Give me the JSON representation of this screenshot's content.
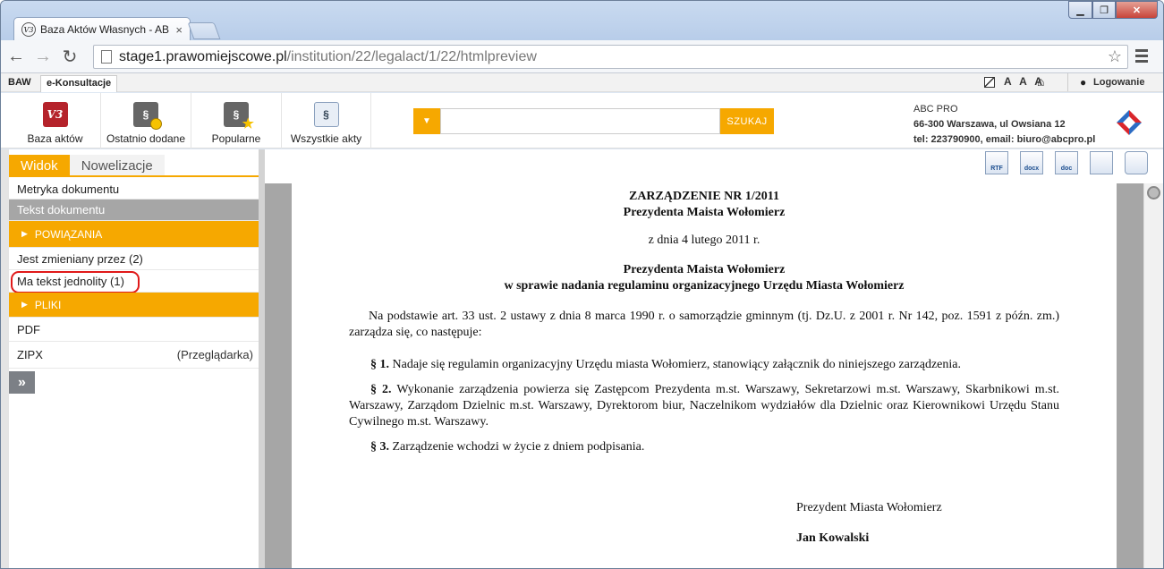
{
  "browser": {
    "tab_title": "Baza Aktów Własnych - AB",
    "favicon_text": "V3",
    "url_host": "stage1.prawomiejscowe.pl",
    "url_path": "/institution/22/legalact/1/22/htmlpreview"
  },
  "sitebar": {
    "baw": "BAW",
    "konsultacje": "e-Konsultacje",
    "accessibility": "A A A",
    "login": "Logowanie"
  },
  "header": {
    "items": [
      {
        "label": "Baza aktów",
        "icon": "baza-aktow-logo-icon"
      },
      {
        "label": "Ostatnio dodane",
        "icon": "recently-added-icon"
      },
      {
        "label": "Popularne",
        "icon": "popular-icon"
      },
      {
        "label": "Wszystkie akty",
        "icon": "all-acts-icon"
      }
    ],
    "search_button": "SZUKAJ",
    "company": {
      "name": "ABC PRO",
      "address": "66-300 Warszawa, ul Owsiana 12",
      "contact": "tel: 223790900, email: biuro@abcpro.pl"
    }
  },
  "left_panel": {
    "tabs": [
      "Widok",
      "Nowelizacje"
    ],
    "rows": {
      "metryka": "Metryka dokumentu",
      "tekst": "Tekst dokumentu",
      "powiazania": "POWIĄZANIA",
      "zmieniany": "Jest zmieniany przez (2)",
      "jednolity": "Ma tekst jednolity (1)",
      "pliki": "PLIKI",
      "pdf": "PDF",
      "zipx": "ZIPX",
      "zipx_right": "(Przeglądarka)"
    },
    "expand": "»"
  },
  "file_icons": [
    "RTF",
    "docx",
    "doc",
    "html",
    "print"
  ],
  "document": {
    "title1": "ZARZĄDZENIE NR 1/2011",
    "title2": "Prezydenta Maista Wołomierz",
    "date": "z dnia 4 lutego 2011 r.",
    "subject1": "Prezydenta Maista Wołomierz",
    "subject2": "w sprawie nadania regulaminu organizacyjnego Urzędu Miasta Wołomierz",
    "intro": "Na podstawie art. 33 ust. 2 ustawy z dnia 8 marca 1990 r. o samorządzie gminnym (tj. Dz.U. z 2001 r. Nr 142, poz. 1591 z późn. zm.) zarządza się, co następuje:",
    "p1_label": "§ 1.",
    "p1": "Nadaje się regulamin organizacyjny Urzędu miasta Wołomierz, stanowiący załącznik do niniejszego zarządzenia.",
    "p2_label": "§ 2.",
    "p2": "Wykonanie zarządzenia powierza się Zastępcom Prezydenta m.st. Warszawy, Sekretarzowi m.st. Warszawy, Skarbnikowi m.st. Warszawy, Zarządom Dzielnic m.st. Warszawy, Dyrektorom biur, Naczelnikom wydziałów dla Dzielnic oraz Kierownikowi Urzędu Stanu Cywilnego m.st. Warszawy.",
    "p3_label": "§ 3.",
    "p3": "Zarządzenie wchodzi w życie z dniem podpisania.",
    "sig_title": "Prezydent Miasta Wołomierz",
    "sig_name": "Jan Kowalski"
  }
}
